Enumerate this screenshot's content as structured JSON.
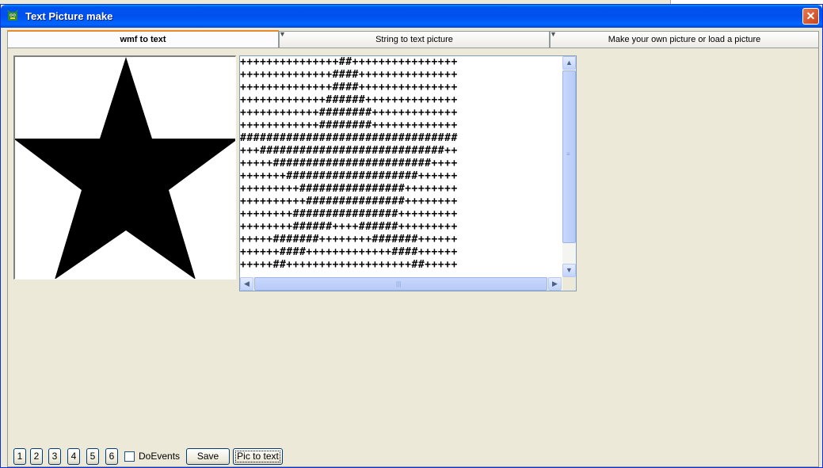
{
  "window": {
    "title": "Text Picture make",
    "close_label": "✕"
  },
  "tabs": [
    {
      "label": "wmf to text"
    },
    {
      "label": "String to text picture"
    },
    {
      "label": "Make your own picture or load a picture"
    }
  ],
  "ascii_lines": [
    "+++++++++++++++##++++++++++++++++",
    "++++++++++++++####+++++++++++++++",
    "++++++++++++++####+++++++++++++++",
    "+++++++++++++######++++++++++++++",
    "++++++++++++########+++++++++++++",
    "++++++++++++########+++++++++++++",
    "#################################",
    "+++############################++",
    "+++++########################++++",
    "+++++++####################++++++",
    "+++++++++################++++++++",
    "++++++++++###############++++++++",
    "++++++++################+++++++++",
    "++++++++######++++######+++++++++",
    "+++++#######++++++++#######++++++",
    "++++++####+++++++++++++####++++++",
    "+++++##+++++++++++++++++++##+++++"
  ],
  "buttons": {
    "numbers": [
      "1",
      "2",
      "3",
      "4",
      "5",
      "6"
    ],
    "doevents_label": "DoEvents",
    "doevents_checked": false,
    "save_label": "Save",
    "pic_to_text_label": "Pic to text"
  },
  "icons": {
    "app": "app-dragon-icon",
    "close": "close-icon",
    "scroll_up": "arrow-up-icon",
    "scroll_down": "arrow-down-icon",
    "scroll_left": "arrow-left-icon",
    "scroll_right": "arrow-right-icon",
    "star": "star-image"
  },
  "colors": {
    "titlebar": "#0054e3",
    "face": "#ece9d8",
    "active_tab_accent": "#e68b2c"
  }
}
